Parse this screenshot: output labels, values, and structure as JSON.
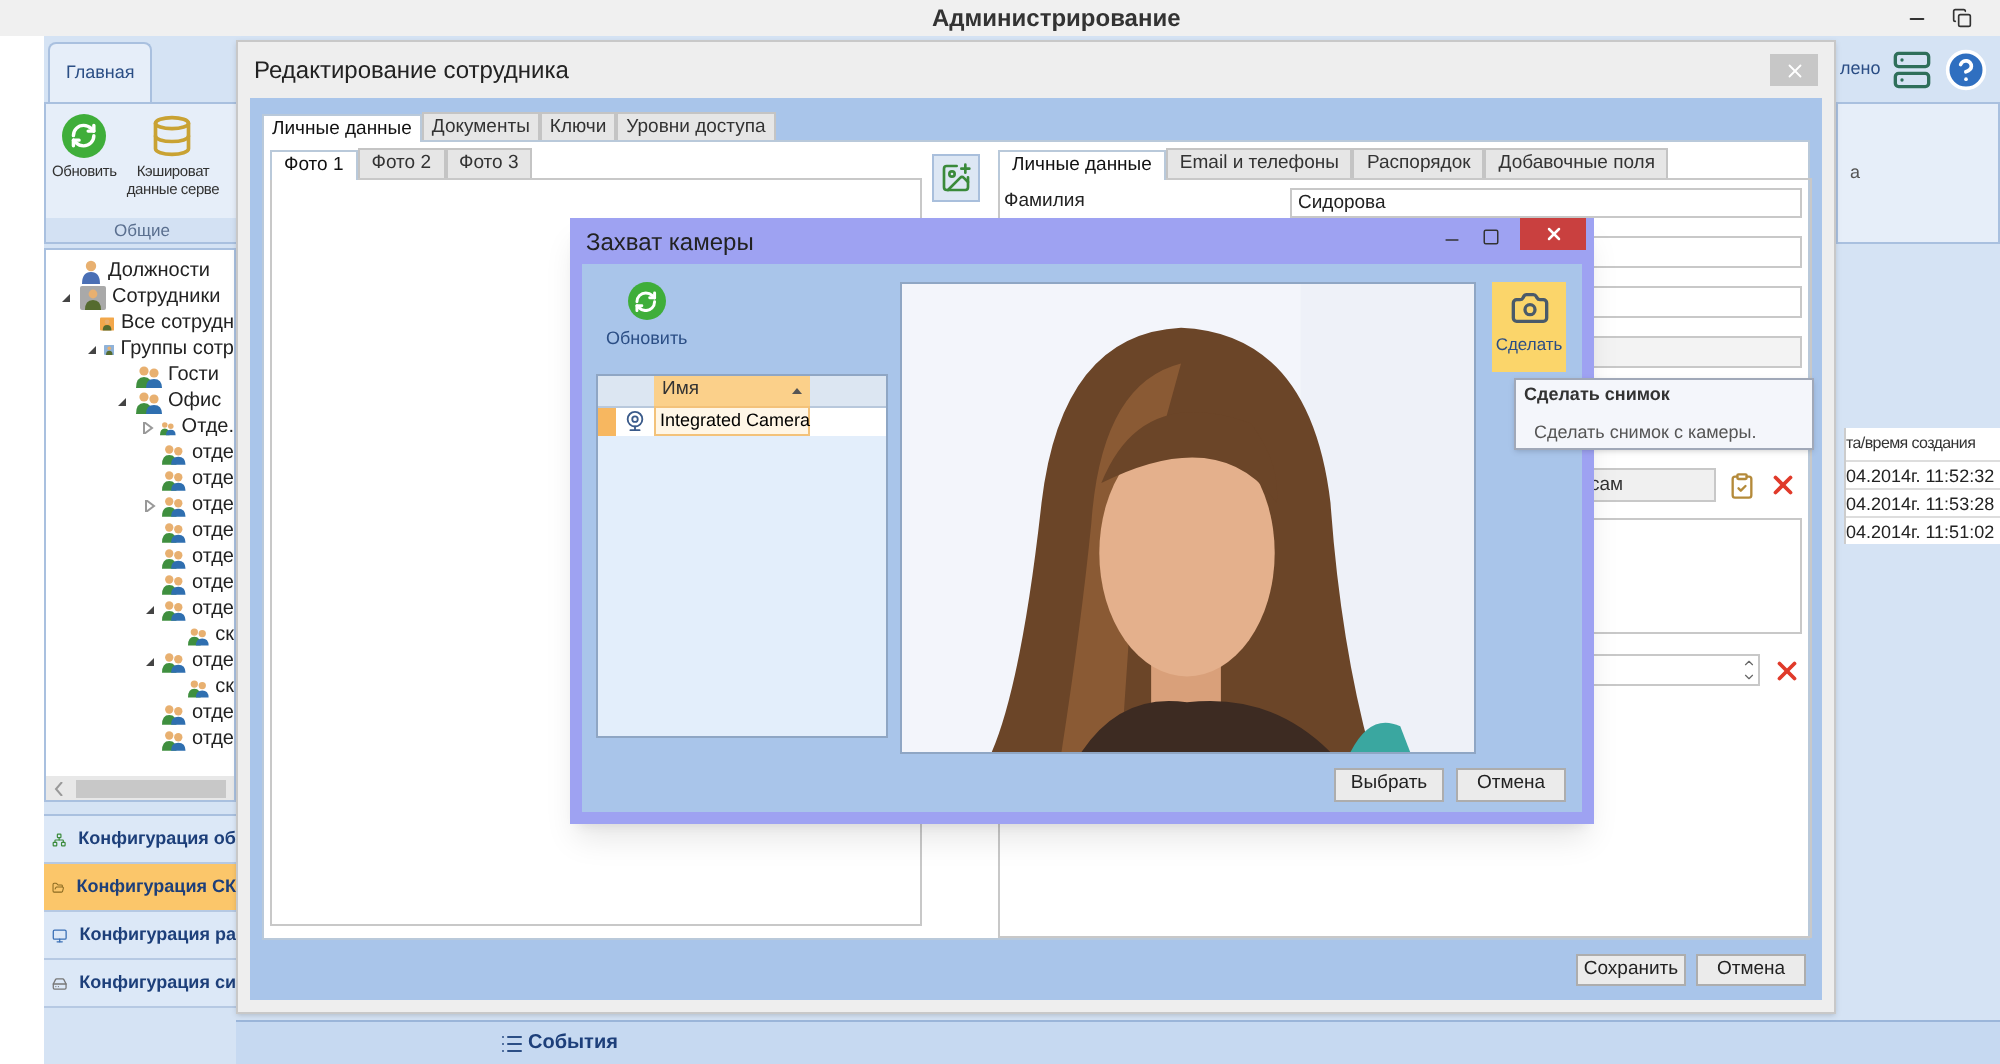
{
  "window": {
    "title": "Администрирование"
  },
  "ribbon": {
    "tabs": [
      {
        "label": "Главная",
        "selected": true
      }
    ],
    "buttons": [
      {
        "kind": "refresh",
        "label": "Обновить"
      },
      {
        "kind": "cache",
        "label": "Кэшироват\nданные серве"
      }
    ],
    "group": "Общие",
    "status_text": "лено",
    "side_text": "а"
  },
  "tree": [
    {
      "kind": "position",
      "label": "Должности"
    },
    {
      "kind": "employees",
      "label": "Сотрудники",
      "expanded": true,
      "children": [
        {
          "kind": "all",
          "label": "Все сотрудн"
        },
        {
          "kind": "groups",
          "label": "Группы сотр",
          "expanded": true,
          "children": [
            {
              "kind": "group",
              "label": "Гости"
            },
            {
              "kind": "group",
              "label": "Офис",
              "expanded": true,
              "children": [
                {
                  "kind": "group",
                  "label": "Отде.",
                  "expanded": false
                },
                {
                  "kind": "group",
                  "label": "отде"
                },
                {
                  "kind": "group",
                  "label": "отде"
                },
                {
                  "kind": "group",
                  "label": "отде",
                  "expanded": false
                },
                {
                  "kind": "group",
                  "label": "отде"
                },
                {
                  "kind": "group",
                  "label": "отде"
                },
                {
                  "kind": "group",
                  "label": "отде"
                },
                {
                  "kind": "group",
                  "label": "отде",
                  "expanded": true,
                  "children": [
                    {
                      "kind": "group",
                      "label": "ск"
                    }
                  ]
                },
                {
                  "kind": "group",
                  "label": "отде",
                  "expanded": true,
                  "children": [
                    {
                      "kind": "group",
                      "label": "ск"
                    }
                  ]
                },
                {
                  "kind": "group",
                  "label": "отде"
                },
                {
                  "kind": "group",
                  "label": "отде"
                }
              ]
            }
          ]
        }
      ]
    }
  ],
  "nav": [
    {
      "kind": "network",
      "label": "Конфигурация об",
      "selected": false
    },
    {
      "kind": "access",
      "label": "Конфигурация СК",
      "selected": true
    },
    {
      "kind": "workstation",
      "label": "Конфигурация ра",
      "selected": false
    },
    {
      "kind": "system",
      "label": "Конфигурация си",
      "selected": false
    }
  ],
  "status_bar": {
    "label": "События"
  },
  "events_table": {
    "header": "та/время создания",
    "rows": [
      "04.2014г. 11:52:32",
      "04.2014г. 11:53:28",
      "04.2014г. 11:51:02"
    ]
  },
  "employee_dialog": {
    "title": "Редактирование сотрудника",
    "tabs": [
      {
        "label": "Личные данные",
        "selected": true
      },
      {
        "label": "Документы",
        "selected": false
      },
      {
        "label": "Ключи",
        "selected": false
      },
      {
        "label": "Уровни доступа",
        "selected": false
      }
    ],
    "photo_tabs": [
      {
        "label": "Фото 1",
        "selected": true
      },
      {
        "label": "Фото 2",
        "selected": false
      },
      {
        "label": "Фото 3",
        "selected": false
      }
    ],
    "detail_tabs": [
      {
        "label": "Личные данные",
        "selected": true
      },
      {
        "label": "Email и телефоны",
        "selected": false
      },
      {
        "label": "Распорядок",
        "selected": false
      },
      {
        "label": "Добавочные поля",
        "selected": false
      }
    ],
    "surname": {
      "label": "Фамилия",
      "value": "Сидорова"
    },
    "combo_value": "сам",
    "buttons": [
      "Сохранить",
      "Отмена"
    ]
  },
  "camera_dialog": {
    "title": "Захват камеры",
    "refresh": "Обновить",
    "column": "Имя",
    "rows": [
      {
        "name": "Integrated Camera",
        "selected": true
      }
    ],
    "snapshot": "Сделать",
    "buttons": [
      "Выбрать",
      "Отмена"
    ]
  },
  "tooltip": {
    "title": "Сделать снимок",
    "text": "Сделать снимок с камеры."
  }
}
